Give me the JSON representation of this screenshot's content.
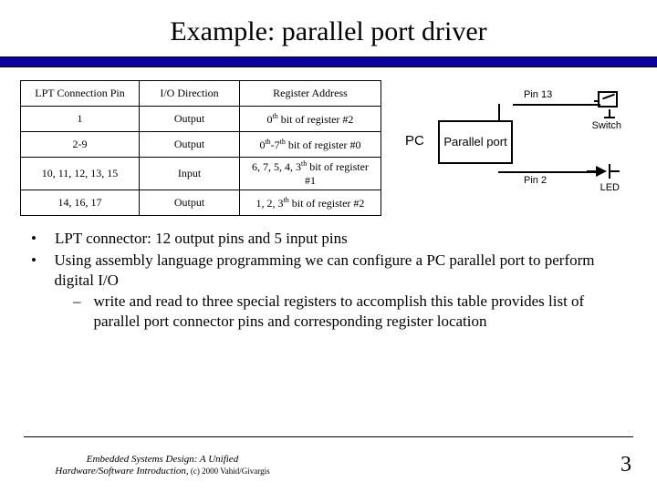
{
  "title": "Example: parallel port driver",
  "table": {
    "headers": [
      "LPT Connection Pin",
      "I/O Direction",
      "Register Address"
    ],
    "rows": [
      {
        "pin": "1",
        "dir": "Output",
        "addr_html": "0<sup>th</sup> bit of register #2"
      },
      {
        "pin": "2-9",
        "dir": "Output",
        "addr_html": "0<sup>th</sup>-7<sup>th</sup> bit of register #0"
      },
      {
        "pin": "10, 11, 12, 13, 15",
        "dir": "Input",
        "addr_html": "6, 7, 5, 4, 3<sup>th</sup> bit of register #1"
      },
      {
        "pin": "14, 16, 17",
        "dir": "Output",
        "addr_html": "1, 2, 3<sup>th</sup> bit of register #2"
      }
    ]
  },
  "diagram": {
    "pc": "PC",
    "parallel_port": "Parallel port",
    "pin13": "Pin 13",
    "pin2": "Pin 2",
    "switch": "Switch",
    "led": "LED"
  },
  "bullets": {
    "b1": "LPT connector: 12 output pins and 5 input pins",
    "b2": "Using assembly language programming we can configure a PC parallel port to perform digital I/O",
    "s1": "write and read to three special registers to accomplish this table provides list of parallel port connector pins and corresponding register location"
  },
  "footer": {
    "credit_line1": "Embedded Systems Design: A Unified",
    "credit_line2": "Hardware/Software Introduction,",
    "copyright": " (c) 2000 Vahid/Givargis",
    "page": "3"
  }
}
